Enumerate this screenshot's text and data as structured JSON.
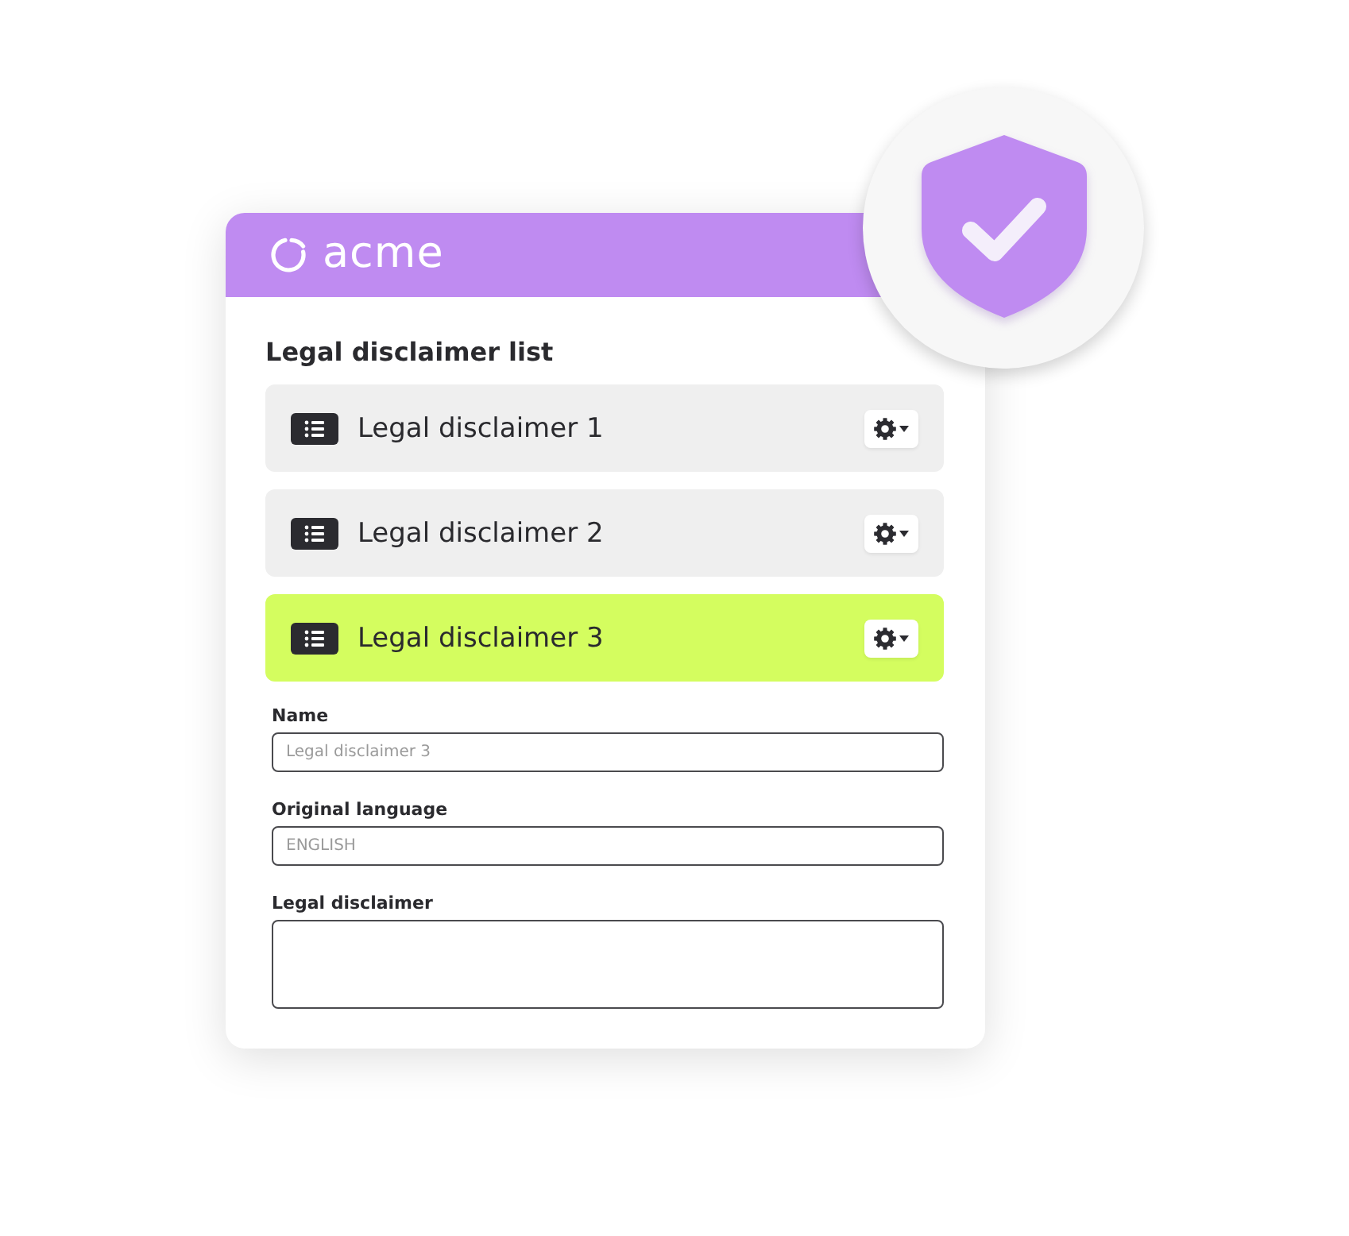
{
  "header": {
    "logo_text": "acme"
  },
  "title": "Legal disclaimer list",
  "items": [
    {
      "label": "Legal disclaimer 1",
      "selected": false
    },
    {
      "label": "Legal disclaimer 2",
      "selected": false
    },
    {
      "label": "Legal disclaimer 3",
      "selected": true
    }
  ],
  "form": {
    "fields": [
      {
        "kind": "input",
        "label": "Name",
        "value": "Legal disclaimer 3"
      },
      {
        "kind": "input",
        "label": "Original language",
        "value": "ENGLISH"
      },
      {
        "kind": "textarea",
        "label": "Legal disclaimer"
      }
    ]
  }
}
